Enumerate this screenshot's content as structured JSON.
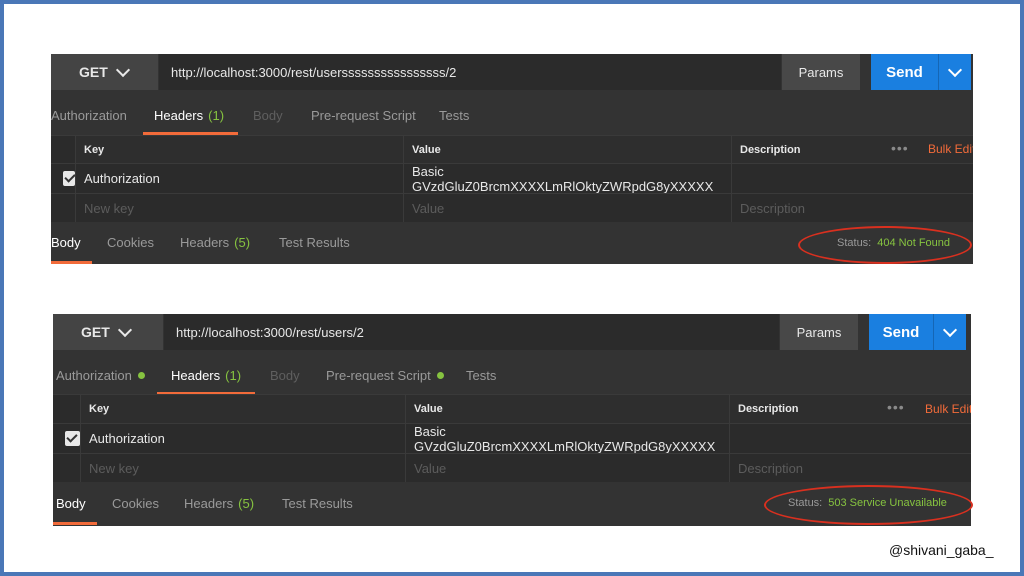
{
  "panels": [
    {
      "method": "GET",
      "url": "http://localhost:3000/rest/userssssssssssssssss/2",
      "params_label": "Params",
      "send_label": "Send",
      "request_tabs": [
        {
          "label": "Authorization",
          "count": "",
          "dot": false,
          "state": "normal"
        },
        {
          "label": "Headers",
          "count": "(1)",
          "dot": false,
          "state": "active"
        },
        {
          "label": "Body",
          "count": "",
          "dot": false,
          "state": "disabled"
        },
        {
          "label": "Pre-request Script",
          "count": "",
          "dot": false,
          "state": "normal"
        },
        {
          "label": "Tests",
          "count": "",
          "dot": false,
          "state": "normal"
        }
      ],
      "columns": {
        "key": "Key",
        "value": "Value",
        "description": "Description",
        "bulk_edit": "Bulk Edit"
      },
      "header_row": {
        "key": "Authorization",
        "value": "Basic GVzdGluZ0BrcmXXXXLmRlOktyZWRpdG8yXXXXX",
        "checked": true
      },
      "placeholders": {
        "key": "New key",
        "value": "Value",
        "description": "Description"
      },
      "response_tabs": [
        {
          "label": "Body",
          "count": "",
          "state": "active"
        },
        {
          "label": "Cookies",
          "count": "",
          "state": "normal"
        },
        {
          "label": "Headers",
          "count": "(5)",
          "state": "normal"
        },
        {
          "label": "Test Results",
          "count": "",
          "state": "normal"
        }
      ],
      "status_label": "Status:",
      "status_value": "404 Not Found"
    },
    {
      "method": "GET",
      "url": "http://localhost:3000/rest/users/2",
      "params_label": "Params",
      "send_label": "Send",
      "request_tabs": [
        {
          "label": "Authorization",
          "count": "",
          "dot": true,
          "state": "normal"
        },
        {
          "label": "Headers",
          "count": "(1)",
          "dot": false,
          "state": "active"
        },
        {
          "label": "Body",
          "count": "",
          "dot": false,
          "state": "disabled"
        },
        {
          "label": "Pre-request Script",
          "count": "",
          "dot": true,
          "state": "normal"
        },
        {
          "label": "Tests",
          "count": "",
          "dot": false,
          "state": "normal"
        }
      ],
      "columns": {
        "key": "Key",
        "value": "Value",
        "description": "Description",
        "bulk_edit": "Bulk Edit"
      },
      "header_row": {
        "key": "Authorization",
        "value": "Basic GVzdGluZ0BrcmXXXXLmRlOktyZWRpdG8yXXXXX",
        "checked": true
      },
      "placeholders": {
        "key": "New key",
        "value": "Value",
        "description": "Description"
      },
      "response_tabs": [
        {
          "label": "Body",
          "count": "",
          "state": "active"
        },
        {
          "label": "Cookies",
          "count": "",
          "state": "normal"
        },
        {
          "label": "Headers",
          "count": "(5)",
          "state": "normal"
        },
        {
          "label": "Test Results",
          "count": "",
          "state": "normal"
        }
      ],
      "status_label": "Status:",
      "status_value": "503 Service Unavailable"
    }
  ],
  "credit": "@shivani_gaba_",
  "colors": {
    "accent_orange": "#f26b3a",
    "send_blue": "#1a7fe0",
    "status_green": "#86c340",
    "annotation_red": "#d9301f"
  }
}
